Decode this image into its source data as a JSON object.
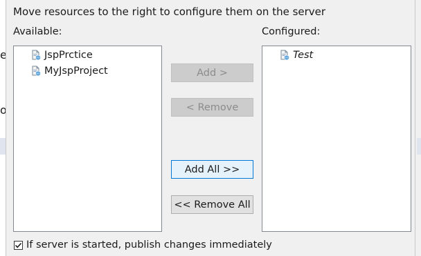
{
  "background": {
    "left_chars": [
      "e",
      "o"
    ]
  },
  "dialog": {
    "instruction": "Move resources to the right to configure them on the server",
    "available_label": "Available:",
    "configured_label": "Configured:",
    "available_items": [
      {
        "label": "JspPrctice",
        "icon": "web-project-icon"
      },
      {
        "label": "MyJspProject",
        "icon": "web-project-icon"
      }
    ],
    "configured_items": [
      {
        "label": "Test",
        "icon": "web-project-icon"
      }
    ],
    "buttons": {
      "add": "Add >",
      "remove": "< Remove",
      "add_all": "Add All >>",
      "remove_all": "<< Remove All"
    },
    "publish_checkbox": {
      "label": "If server is started, publish changes immediately",
      "checked": true
    }
  }
}
